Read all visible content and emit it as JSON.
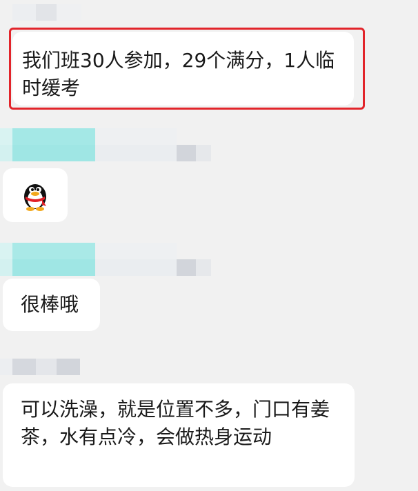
{
  "messages": [
    {
      "text": "我们班30人参加，29个满分，1人临时缓考",
      "highlighted": true
    },
    {
      "sticker": "qq-penguin-icon"
    },
    {
      "text": "很棒哦"
    },
    {
      "text": "可以洗澡，就是位置不多，门口有姜茶，水有点冷，会做热身运动"
    }
  ],
  "colors": {
    "highlight": "#e2242a",
    "bubble": "#ffffff",
    "background": "#f1f1f1",
    "blur_teal": "#9fe6e4",
    "blur_gray": "#d9dbe0"
  }
}
